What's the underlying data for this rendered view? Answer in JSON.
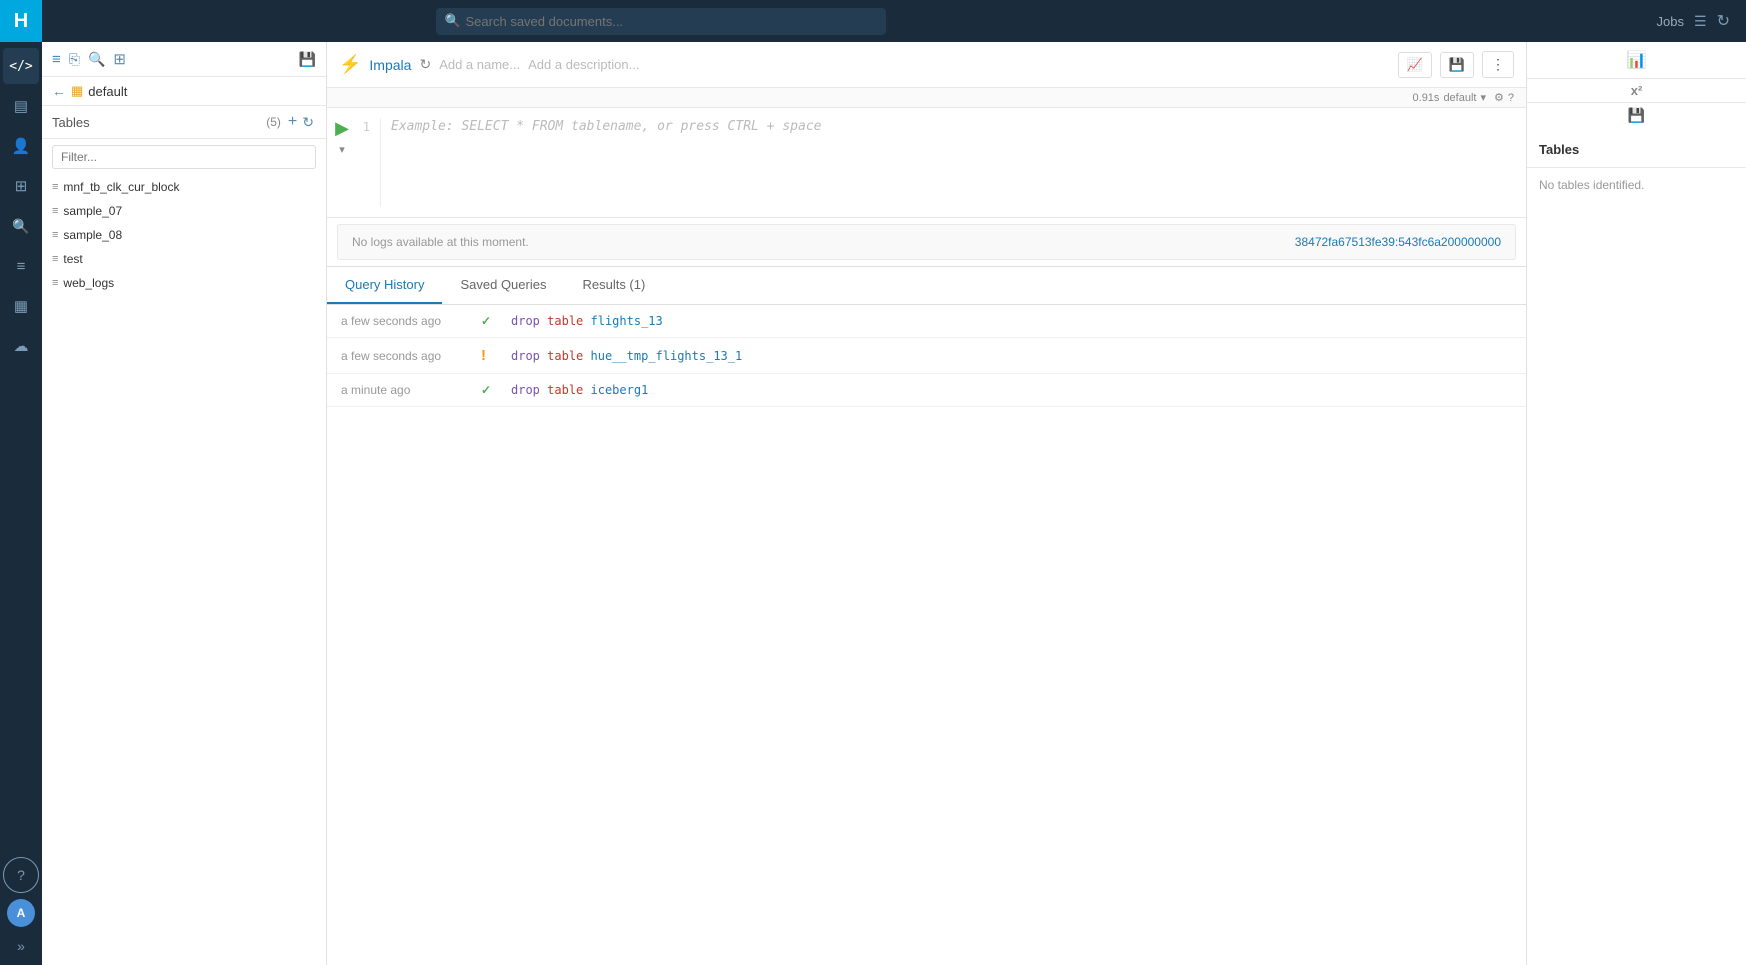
{
  "topbar": {
    "search_placeholder": "Search saved documents...",
    "jobs_label": "Jobs",
    "refresh_icon": "↻"
  },
  "nav": {
    "logo": "H",
    "items": [
      {
        "name": "code",
        "icon": "</>"
      },
      {
        "name": "dashboard",
        "icon": "▦"
      },
      {
        "name": "user",
        "icon": "👤"
      },
      {
        "name": "tables",
        "icon": "⊞"
      },
      {
        "name": "search-nav",
        "icon": "🔍"
      },
      {
        "name": "workflows",
        "icon": "≡"
      },
      {
        "name": "apps",
        "icon": "⊞"
      },
      {
        "name": "cloud",
        "icon": "☁"
      }
    ],
    "bottom": [
      {
        "name": "help",
        "icon": "?"
      },
      {
        "name": "avatar",
        "text": "A"
      }
    ],
    "expand_icon": "»"
  },
  "left_panel": {
    "toolbar_icons": [
      "table-icon",
      "copy-icon",
      "search-icon",
      "grid-icon",
      "save-icon"
    ],
    "breadcrumb": {
      "back": "←",
      "db_icon": "▦",
      "db_name": "default"
    },
    "tables": {
      "title": "Tables",
      "count": "(5)",
      "filter_placeholder": "Filter...",
      "items": [
        {
          "name": "mnf_tb_clk_cur_block"
        },
        {
          "name": "sample_07"
        },
        {
          "name": "sample_08"
        },
        {
          "name": "test"
        },
        {
          "name": "web_logs"
        }
      ]
    }
  },
  "editor": {
    "engine_name": "Impala",
    "refresh_icon": "↻",
    "name_placeholder": "Add a name...",
    "desc_placeholder": "Add a description...",
    "toolbar_right": {
      "chart_icon": "📈",
      "save_icon": "💾",
      "more_icon": "⋮"
    },
    "status_bar": {
      "time": "0.91s",
      "db": "default",
      "settings_icon": "⚙",
      "help_icon": "?"
    },
    "line_number": "1",
    "placeholder": "Example: SELECT * FROM tablename, or press CTRL + space",
    "run_icon": "▶",
    "logs": {
      "message": "No logs available at this moment.",
      "log_id": "38472fa67513fe39:543fc6a200000000"
    }
  },
  "tabs": {
    "items": [
      {
        "label": "Query History",
        "id": "query-history",
        "active": true
      },
      {
        "label": "Saved Queries",
        "id": "saved-queries",
        "active": false
      },
      {
        "label": "Results (1)",
        "id": "results",
        "active": false
      }
    ]
  },
  "query_history": {
    "rows": [
      {
        "time": "a few seconds ago",
        "status": "success",
        "status_icon": "✓",
        "query_parts": [
          {
            "text": "drop",
            "type": "keyword"
          },
          {
            "text": " "
          },
          {
            "text": "table",
            "type": "keyword2"
          },
          {
            "text": " "
          },
          {
            "text": "flights_13",
            "type": "table"
          }
        ],
        "query_raw": "drop table flights_13"
      },
      {
        "time": "a few seconds ago",
        "status": "warning",
        "status_icon": "!",
        "query_parts": [
          {
            "text": "drop",
            "type": "keyword"
          },
          {
            "text": " "
          },
          {
            "text": "table",
            "type": "keyword2"
          },
          {
            "text": " "
          },
          {
            "text": "hue__tmp_flights_13_1",
            "type": "table"
          }
        ],
        "query_raw": "drop table hue__tmp_flights_13_1"
      },
      {
        "time": "a minute ago",
        "status": "success",
        "status_icon": "✓",
        "query_parts": [
          {
            "text": "drop",
            "type": "keyword"
          },
          {
            "text": " "
          },
          {
            "text": "table",
            "type": "keyword2"
          },
          {
            "text": " "
          },
          {
            "text": "iceberg1",
            "type": "table"
          }
        ],
        "query_raw": "drop table iceberg1"
      }
    ]
  },
  "right_panel": {
    "title": "Tables",
    "empty_message": "No tables identified.",
    "icons": [
      "x2",
      "db-icon"
    ]
  }
}
